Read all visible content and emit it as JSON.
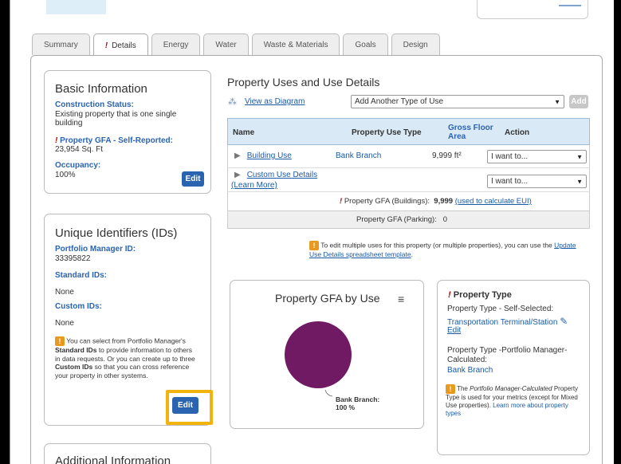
{
  "tabs": [
    {
      "label": "Summary",
      "warn": false
    },
    {
      "label": "Details",
      "warn": true
    },
    {
      "label": "Energy",
      "warn": false
    },
    {
      "label": "Water",
      "warn": false
    },
    {
      "label": "Waste & Materials",
      "warn": false
    },
    {
      "label": "Goals",
      "warn": false
    },
    {
      "label": "Design",
      "warn": false
    }
  ],
  "basic_info": {
    "title": "Basic Information",
    "construction_label": "Construction Status:",
    "construction_value": "Existing property that is one single building",
    "gfa_label": "Property GFA - Self-Reported:",
    "gfa_value": "23,954 Sq. Ft",
    "occupancy_label": "Occupancy:",
    "occupancy_value": "100%",
    "edit_label": "Edit"
  },
  "unique_ids": {
    "title": "Unique Identifiers (IDs)",
    "pm_id_label": "Portfolio Manager ID:",
    "pm_id_value": "33395822",
    "standard_label": "Standard IDs:",
    "standard_value": "None",
    "custom_label": "Custom IDs:",
    "custom_value": "None",
    "note_1": "You can select from Portfolio Manager's",
    "note_2": "Standard IDs",
    "note_3": "to provide information to others in data requests. Or you can create up to three",
    "note_4": "Custom IDs",
    "note_5": "so that you can cross reference your property in other systems.",
    "edit_label": "Edit"
  },
  "additional_info": {
    "title": "Additional Information"
  },
  "uses": {
    "title": "Property Uses and Use Details",
    "diagram_link": "View as Diagram",
    "add_select": "Add Another Type of Use",
    "add_button": "Add",
    "headers": {
      "name": "Name",
      "type": "Property Use Type",
      "gfa": "Gross Floor Area",
      "action": "Action"
    },
    "rows": [
      {
        "name": "Building Use",
        "type": "Bank Branch",
        "gfa": "9,999 ft²",
        "action": "I want to..."
      },
      {
        "name": "Custom Use Details",
        "learn": "(Learn More)",
        "type": "",
        "gfa": "",
        "action": "I want to..."
      }
    ],
    "gfa_buildings_label": "Property GFA (Buildings):",
    "gfa_buildings_value": "9,999",
    "gfa_buildings_link": "(used to calculate EUI)",
    "gfa_parking_label": "Property GFA (Parking):",
    "gfa_parking_value": "0",
    "note_pre": "To edit multiple uses for this property (or multiple properties), you can use the",
    "note_link": "Update Use Details spreadsheet template",
    "note_post": "."
  },
  "gfa_chart": {
    "title": "Property GFA by Use",
    "menu_icon": "hamburger-icon",
    "slice_color": "#6f1a63"
  },
  "chart_data": {
    "type": "pie",
    "title": "Property GFA by Use",
    "categories": [
      "Bank Branch"
    ],
    "values": [
      100
    ],
    "labels": [
      "Bank Branch:",
      "100 %"
    ]
  },
  "property_type": {
    "title": "Property Type",
    "self_label": "Property Type - Self-Selected:",
    "self_value": "Transportation Terminal/Station",
    "edit_link": "Edit",
    "pm_label": "Property Type -Portfolio Manager-Calculated:",
    "pm_value": "Bank Branch",
    "note_1": "The",
    "note_2": "Portfolio Manager-Calculated",
    "note_3": "Property Type is used for your metrics (except for Mixed Use properties).",
    "note_link": "Learn more about property types"
  }
}
